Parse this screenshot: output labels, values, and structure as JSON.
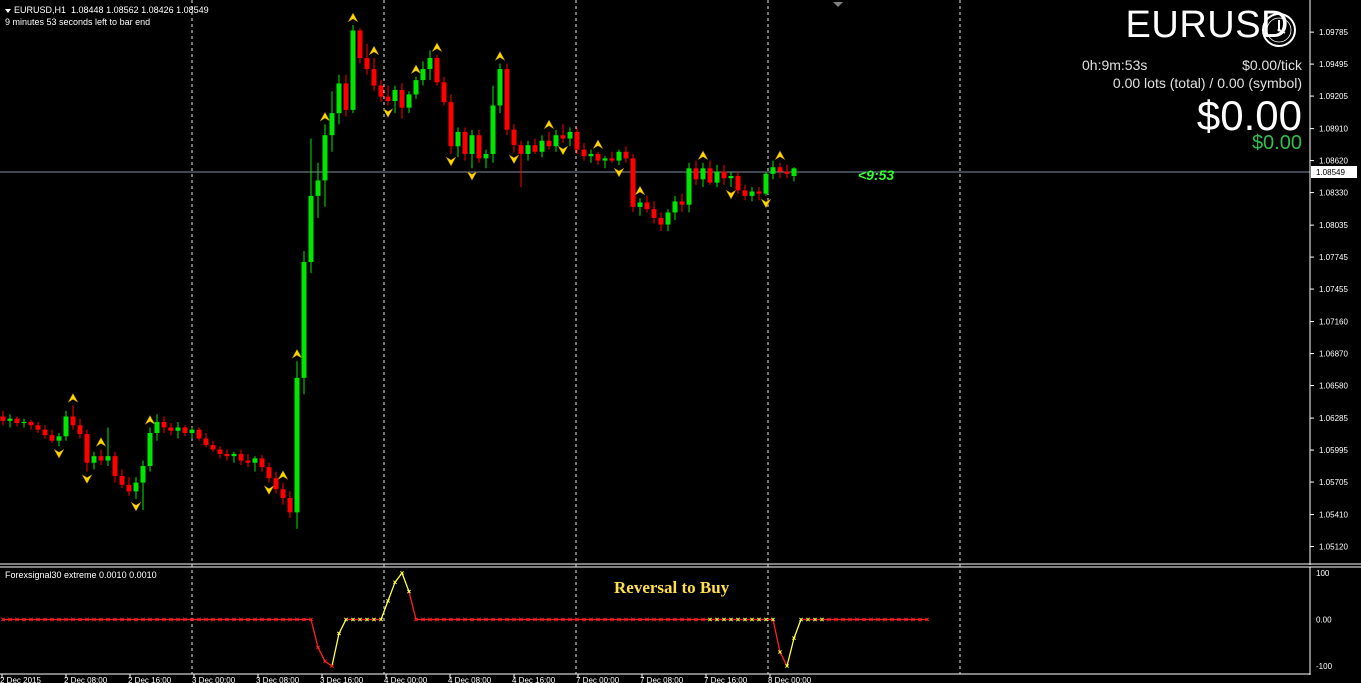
{
  "header": {
    "symbol_period": "EURUSD,H1",
    "ohlc": "1.08448 1.08562 1.08426 1.08549",
    "bar_timer": "9 minutes 53 seconds left to bar end"
  },
  "panel": {
    "symbol": "EURUSD",
    "time_left": "0h:9m:53s",
    "per_tick": "$0.00/tick",
    "lots": "0.00 lots (total) / 0.00 (symbol)",
    "profit_big": "$0.00",
    "profit_small": "$0.00",
    "clock_icon": "clock-icon"
  },
  "countdown": "<9:53",
  "current_price_label": "1.08549",
  "indicator": {
    "label": "Forexsignal30 extreme 0.0010 0.0010",
    "annotation": "Reversal to Buy",
    "levels": [
      "100",
      "0.00",
      "-100"
    ]
  },
  "colors": {
    "bull": "#00e600",
    "bear": "#ff0000",
    "signal": "#ffd700",
    "grid": "#ffffff",
    "ind_red": "#ff2020",
    "ind_yellow": "#ffff40"
  },
  "chart_data": {
    "type": "candlestick",
    "price_ticks": [
      "1.09785",
      "1.09495",
      "1.09205",
      "1.08910",
      "1.08620",
      "1.08330",
      "1.08035",
      "1.07745",
      "1.07455",
      "1.07160",
      "1.06870",
      "1.06580",
      "1.06285",
      "1.05995",
      "1.05705",
      "1.05410",
      "1.05120"
    ],
    "date_ticks": [
      "2 Dec 2015",
      "2 Dec 08:00",
      "2 Dec 16:00",
      "3 Dec 00:00",
      "3 Dec 08:00",
      "3 Dec 16:00",
      "4 Dec 00:00",
      "4 Dec 08:00",
      "4 Dec 16:00",
      "7 Dec 00:00",
      "7 Dec 08:00",
      "7 Dec 16:00",
      "8 Dec 00:00"
    ],
    "ylim": [
      1.0498,
      1.1004
    ],
    "candles": [
      [
        1.063,
        1.0635,
        1.0622,
        1.0626
      ],
      [
        1.0626,
        1.0632,
        1.062,
        1.0628
      ],
      [
        1.0628,
        1.063,
        1.0621,
        1.0624
      ],
      [
        1.0624,
        1.0628,
        1.062,
        1.0625
      ],
      [
        1.0625,
        1.0627,
        1.0618,
        1.0622
      ],
      [
        1.0622,
        1.0625,
        1.0615,
        1.0618
      ],
      [
        1.0618,
        1.0622,
        1.061,
        1.0613
      ],
      [
        1.0613,
        1.0618,
        1.0606,
        1.0608
      ],
      [
        1.0608,
        1.0615,
        1.0603,
        1.0612
      ],
      [
        1.0612,
        1.0635,
        1.0608,
        1.063
      ],
      [
        1.063,
        1.064,
        1.0618,
        1.0622
      ],
      [
        1.0622,
        1.0628,
        1.061,
        1.0614
      ],
      [
        1.0614,
        1.0618,
        1.058,
        1.0588
      ],
      [
        1.0588,
        1.0598,
        1.0582,
        1.0594
      ],
      [
        1.0594,
        1.06,
        1.0586,
        1.059
      ],
      [
        1.059,
        1.062,
        1.0585,
        1.0594
      ],
      [
        1.0594,
        1.0598,
        1.057,
        1.0576
      ],
      [
        1.0576,
        1.0582,
        1.0565,
        1.0568
      ],
      [
        1.0568,
        1.0575,
        1.0558,
        1.0562
      ],
      [
        1.0562,
        1.0575,
        1.0555,
        1.057
      ],
      [
        1.057,
        1.059,
        1.0545,
        1.0585
      ],
      [
        1.0585,
        1.062,
        1.058,
        1.0615
      ],
      [
        1.0615,
        1.0632,
        1.0608,
        1.0625
      ],
      [
        1.0625,
        1.063,
        1.0615,
        1.062
      ],
      [
        1.062,
        1.0624,
        1.0613,
        1.0617
      ],
      [
        1.0617,
        1.0625,
        1.061,
        1.062
      ],
      [
        1.062,
        1.0622,
        1.0612,
        1.0615
      ],
      [
        1.0615,
        1.062,
        1.061,
        1.0618
      ],
      [
        1.0618,
        1.062,
        1.0608,
        1.061
      ],
      [
        1.061,
        1.0615,
        1.0602,
        1.0604
      ],
      [
        1.0604,
        1.0608,
        1.0598,
        1.06
      ],
      [
        1.06,
        1.0603,
        1.0592,
        1.0596
      ],
      [
        1.0596,
        1.06,
        1.059,
        1.0594
      ],
      [
        1.0594,
        1.0598,
        1.0588,
        1.0596
      ],
      [
        1.0596,
        1.06,
        1.0586,
        1.059
      ],
      [
        1.059,
        1.0596,
        1.0584,
        1.0588
      ],
      [
        1.0588,
        1.0594,
        1.058,
        1.0592
      ],
      [
        1.0592,
        1.0595,
        1.058,
        1.0584
      ],
      [
        1.0584,
        1.0588,
        1.057,
        1.0574
      ],
      [
        1.0574,
        1.058,
        1.056,
        1.0564
      ],
      [
        1.0564,
        1.057,
        1.055,
        1.0556
      ],
      [
        1.0556,
        1.0562,
        1.0538,
        1.0543
      ],
      [
        1.0543,
        1.068,
        1.0528,
        1.0665
      ],
      [
        1.0665,
        1.078,
        1.065,
        1.077
      ],
      [
        1.077,
        1.0882,
        1.076,
        1.083
      ],
      [
        1.083,
        1.086,
        1.081,
        1.0844
      ],
      [
        1.0844,
        1.0895,
        1.082,
        1.0885
      ],
      [
        1.0885,
        1.0925,
        1.087,
        1.0905
      ],
      [
        1.0905,
        1.094,
        1.0895,
        1.0932
      ],
      [
        1.0932,
        1.094,
        1.0902,
        1.0908
      ],
      [
        1.0908,
        1.0985,
        1.0905,
        1.098
      ],
      [
        1.098,
        1.0982,
        1.095,
        1.0955
      ],
      [
        1.0955,
        1.0968,
        1.094,
        1.0945
      ],
      [
        1.0945,
        1.0955,
        1.0925,
        1.093
      ],
      [
        1.093,
        1.0935,
        1.0915,
        1.092
      ],
      [
        1.092,
        1.093,
        1.0912,
        1.0916
      ],
      [
        1.0916,
        1.093,
        1.0905,
        1.0926
      ],
      [
        1.0926,
        1.0932,
        1.09,
        1.091
      ],
      [
        1.091,
        1.0925,
        1.0905,
        1.0922
      ],
      [
        1.0922,
        1.0938,
        1.0918,
        1.0935
      ],
      [
        1.0935,
        1.0952,
        1.093,
        1.0945
      ],
      [
        1.0945,
        1.0962,
        1.0935,
        1.0955
      ],
      [
        1.0955,
        1.0958,
        1.093,
        1.0933
      ],
      [
        1.0933,
        1.0938,
        1.0912,
        1.0915
      ],
      [
        1.0915,
        1.0922,
        1.0868,
        1.0875
      ],
      [
        1.0875,
        1.0892,
        1.0865,
        1.0888
      ],
      [
        1.0888,
        1.0892,
        1.0862,
        1.0868
      ],
      [
        1.0868,
        1.089,
        1.0855,
        1.0885
      ],
      [
        1.0885,
        1.089,
        1.086,
        1.0864
      ],
      [
        1.0864,
        1.0872,
        1.0855,
        1.0868
      ],
      [
        1.0868,
        1.093,
        1.086,
        1.0912
      ],
      [
        1.0912,
        1.095,
        1.0905,
        1.0945
      ],
      [
        1.0945,
        1.095,
        1.0885,
        1.089
      ],
      [
        1.089,
        1.0895,
        1.087,
        1.0876
      ],
      [
        1.0876,
        1.088,
        1.0838,
        1.0868
      ],
      [
        1.0868,
        1.088,
        1.0862,
        1.0876
      ],
      [
        1.0876,
        1.0882,
        1.0868,
        1.087
      ],
      [
        1.087,
        1.0885,
        1.0865,
        1.088
      ],
      [
        1.088,
        1.0888,
        1.0872,
        1.0875
      ],
      [
        1.0875,
        1.089,
        1.087,
        1.0885
      ],
      [
        1.0885,
        1.0895,
        1.0878,
        1.0882
      ],
      [
        1.0882,
        1.0892,
        1.0875,
        1.0888
      ],
      [
        1.0888,
        1.0892,
        1.0868,
        1.0872
      ],
      [
        1.0872,
        1.0878,
        1.0862,
        1.0866
      ],
      [
        1.0866,
        1.0872,
        1.086,
        1.0868
      ],
      [
        1.0868,
        1.087,
        1.0858,
        1.0862
      ],
      [
        1.0862,
        1.0866,
        1.0855,
        1.0864
      ],
      [
        1.0864,
        1.087,
        1.086,
        1.0862
      ],
      [
        1.0862,
        1.0872,
        1.0858,
        1.087
      ],
      [
        1.087,
        1.0875,
        1.086,
        1.0864
      ],
      [
        1.0864,
        1.0868,
        1.0815,
        1.082
      ],
      [
        1.082,
        1.0828,
        1.0812,
        1.0824
      ],
      [
        1.0824,
        1.083,
        1.0815,
        1.0818
      ],
      [
        1.0818,
        1.0825,
        1.0805,
        1.081
      ],
      [
        1.081,
        1.0815,
        1.0798,
        1.0804
      ],
      [
        1.0804,
        1.0818,
        1.0798,
        1.0815
      ],
      [
        1.0815,
        1.083,
        1.0808,
        1.0825
      ],
      [
        1.0825,
        1.0832,
        1.0815,
        1.0822
      ],
      [
        1.0822,
        1.086,
        1.0815,
        1.0855
      ],
      [
        1.0855,
        1.0862,
        1.084,
        1.0845
      ],
      [
        1.0845,
        1.086,
        1.0838,
        1.0855
      ],
      [
        1.0855,
        1.0862,
        1.084,
        1.0842
      ],
      [
        1.0842,
        1.0858,
        1.0838,
        1.0852
      ],
      [
        1.0852,
        1.0858,
        1.084,
        1.0846
      ],
      [
        1.0846,
        1.0852,
        1.0838,
        1.0848
      ],
      [
        1.0848,
        1.0852,
        1.0832,
        1.0835
      ],
      [
        1.0835,
        1.084,
        1.0826,
        1.083
      ],
      [
        1.083,
        1.0838,
        1.0825,
        1.0834
      ],
      [
        1.0834,
        1.0838,
        1.0826,
        1.0832
      ],
      [
        1.0832,
        1.0852,
        1.083,
        1.085
      ],
      [
        1.085,
        1.0862,
        1.0845,
        1.0856
      ],
      [
        1.0856,
        1.086,
        1.0846,
        1.0852
      ],
      [
        1.0852,
        1.0858,
        1.0846,
        1.085
      ],
      [
        1.0848,
        1.0856,
        1.0843,
        1.0855
      ]
    ],
    "signals": [
      {
        "bar": 10,
        "dir": "up"
      },
      {
        "bar": 8,
        "dir": "down"
      },
      {
        "bar": 14,
        "dir": "up"
      },
      {
        "bar": 12,
        "dir": "down"
      },
      {
        "bar": 21,
        "dir": "up"
      },
      {
        "bar": 19,
        "dir": "down"
      },
      {
        "bar": 38,
        "dir": "down"
      },
      {
        "bar": 40,
        "dir": "up"
      },
      {
        "bar": 42,
        "dir": "up"
      },
      {
        "bar": 46,
        "dir": "up"
      },
      {
        "bar": 50,
        "dir": "up"
      },
      {
        "bar": 53,
        "dir": "up"
      },
      {
        "bar": 55,
        "dir": "down"
      },
      {
        "bar": 59,
        "dir": "up"
      },
      {
        "bar": 62,
        "dir": "up"
      },
      {
        "bar": 64,
        "dir": "down"
      },
      {
        "bar": 67,
        "dir": "down"
      },
      {
        "bar": 71,
        "dir": "up"
      },
      {
        "bar": 73,
        "dir": "down"
      },
      {
        "bar": 78,
        "dir": "up"
      },
      {
        "bar": 80,
        "dir": "down"
      },
      {
        "bar": 85,
        "dir": "up"
      },
      {
        "bar": 88,
        "dir": "down"
      },
      {
        "bar": 91,
        "dir": "up"
      },
      {
        "bar": 100,
        "dir": "up"
      },
      {
        "bar": 104,
        "dir": "down"
      },
      {
        "bar": 109,
        "dir": "down"
      },
      {
        "bar": 111,
        "dir": "up"
      },
      {
        "bar": 114,
        "dir": "down"
      },
      {
        "bar": 115,
        "dir": "up"
      }
    ],
    "indicator_range": [
      -100,
      100
    ],
    "indicator_values": [
      0,
      0,
      0,
      0,
      0,
      0,
      0,
      0,
      0,
      0,
      0,
      0,
      0,
      0,
      0,
      0,
      0,
      0,
      0,
      0,
      0,
      0,
      0,
      0,
      0,
      0,
      0,
      0,
      0,
      0,
      0,
      0,
      0,
      0,
      0,
      0,
      0,
      0,
      0,
      0,
      0,
      0,
      0,
      0,
      0,
      -60,
      -90,
      -100,
      -30,
      0,
      0,
      0,
      0,
      0,
      0,
      40,
      80,
      100,
      60,
      0,
      0,
      0,
      0,
      0,
      0,
      0,
      0,
      0,
      0,
      0,
      0,
      0,
      0,
      0,
      0,
      0,
      0,
      0,
      0,
      0,
      0,
      0,
      0,
      0,
      0,
      0,
      0,
      0,
      0,
      0,
      0,
      0,
      0,
      0,
      0,
      0,
      0,
      0,
      0,
      0,
      0,
      0,
      0,
      0,
      0,
      0,
      0,
      0,
      0,
      0,
      0,
      -70,
      -100,
      -40,
      0,
      0,
      0,
      0,
      0,
      0,
      0,
      0,
      0,
      0,
      0,
      0,
      0,
      0,
      0,
      0,
      0,
      0,
      0
    ]
  }
}
